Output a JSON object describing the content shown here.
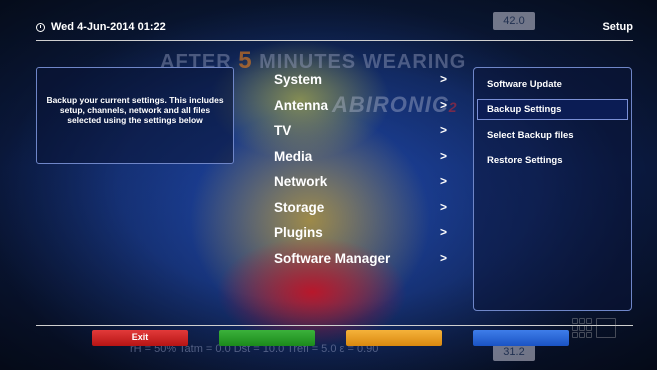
{
  "header": {
    "datetime": "Wed  4-Jun-2014 01:22",
    "screen_title": "Setup"
  },
  "background": {
    "watermark_before": "AFTER ",
    "watermark_number": "5",
    "watermark_after": " MINUTES WEARING",
    "logo_text": "ABIRONIC",
    "logo_suffix": "2",
    "temp_top": "42.0",
    "temp_bottom": "31.2",
    "footer_readout": "rH = 50%  Tatm = 0.0  Dst = 10.0  Trefl = 5.0  ε = 0.90"
  },
  "info": {
    "text": "Backup your current settings. This includes setup, channels, network and all files selected using the settings below"
  },
  "menu": {
    "items": [
      {
        "label": "System",
        "arrow": ">"
      },
      {
        "label": "Antenna",
        "arrow": ">"
      },
      {
        "label": "TV",
        "arrow": ">"
      },
      {
        "label": "Media",
        "arrow": ">"
      },
      {
        "label": "Network",
        "arrow": ">"
      },
      {
        "label": "Storage",
        "arrow": ">"
      },
      {
        "label": "Plugins",
        "arrow": ">"
      },
      {
        "label": "Software Manager",
        "arrow": ">"
      }
    ]
  },
  "submenu": {
    "items": [
      {
        "label": "Software Update",
        "selected": false
      },
      {
        "label": "Backup Settings",
        "selected": true
      },
      {
        "label": "Select Backup files",
        "selected": false
      },
      {
        "label": "Restore Settings",
        "selected": false
      }
    ]
  },
  "buttons": {
    "red_label": "Exit",
    "green_label": "",
    "yellow_label": "",
    "blue_label": ""
  },
  "colors": {
    "red": "#d42020",
    "green": "#27a027",
    "yellow": "#f0a020",
    "blue": "#2d68dc",
    "accent_border": "#6f86c8"
  }
}
